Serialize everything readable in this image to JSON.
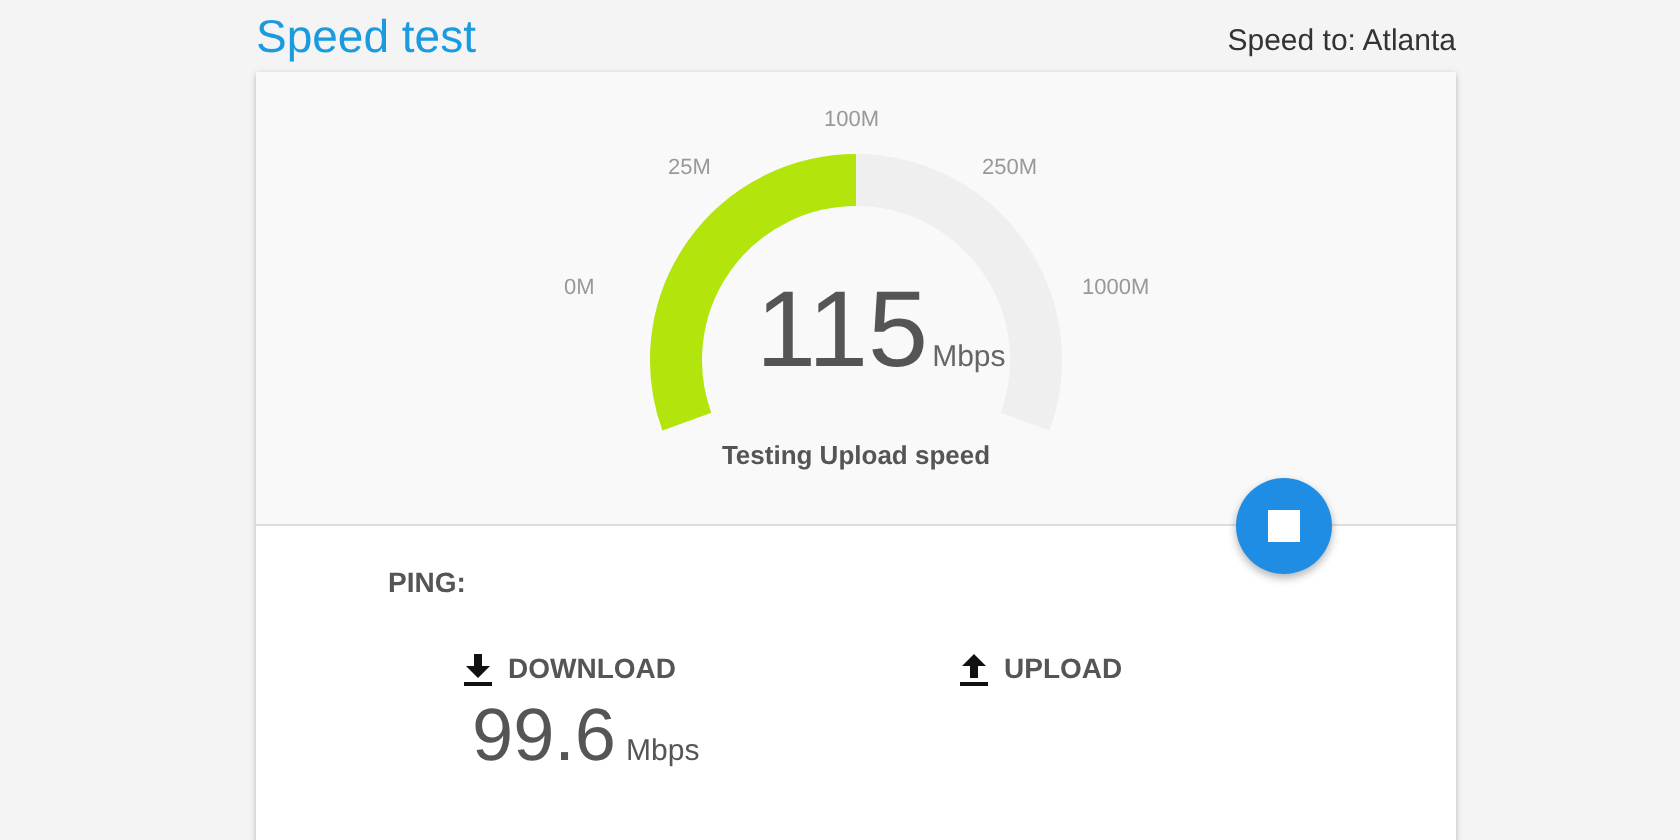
{
  "header": {
    "title": "Speed test",
    "server": "Speed to: Atlanta"
  },
  "gauge": {
    "ticks": [
      "0M",
      "25M",
      "100M",
      "250M",
      "1000M"
    ],
    "value": "115",
    "unit": "Mbps",
    "status": "Testing Upload speed"
  },
  "results": {
    "ping_label": "PING:",
    "items": [
      {
        "kind": "download",
        "label": "DOWNLOAD",
        "value": "99.6",
        "unit": "Mbps"
      },
      {
        "kind": "upload",
        "label": "UPLOAD"
      }
    ]
  }
}
